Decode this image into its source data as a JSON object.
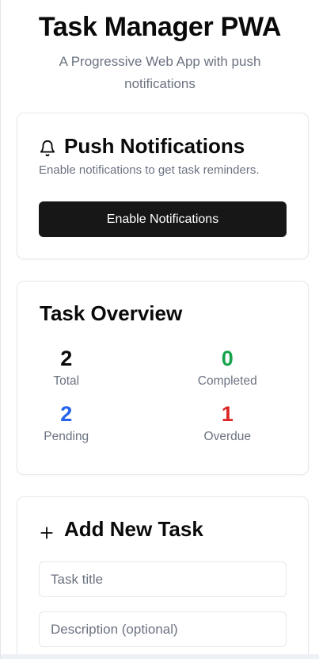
{
  "header": {
    "title": "Task Manager PWA",
    "subtitle": "A Progressive Web App with push notifications"
  },
  "notifications": {
    "heading": "Push Notifications",
    "icon": "bell-icon",
    "description": "Enable notifications to get task reminders.",
    "button_label": "Enable Notifications"
  },
  "overview": {
    "heading": "Task Overview",
    "stats": [
      {
        "value": "2",
        "label": "Total",
        "color": "#0a0a0a"
      },
      {
        "value": "0",
        "label": "Completed",
        "color": "#16a34a"
      },
      {
        "value": "2",
        "label": "Pending",
        "color": "#2563eb"
      },
      {
        "value": "1",
        "label": "Overdue",
        "color": "#dc2626"
      }
    ]
  },
  "add_task": {
    "heading": "Add New Task",
    "icon": "plus-icon",
    "title_placeholder": "Task title",
    "description_placeholder": "Description (optional)"
  },
  "colors": {
    "button_bg": "#171717",
    "muted_text": "#6b7280",
    "border": "#e5e7eb"
  }
}
